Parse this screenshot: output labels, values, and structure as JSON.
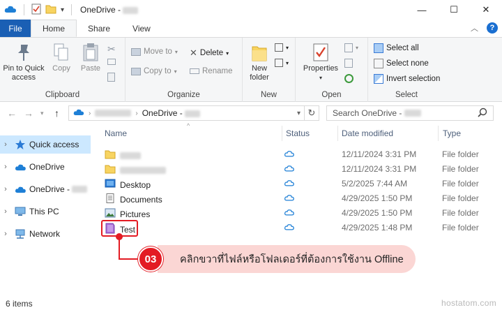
{
  "window": {
    "title": "OneDrive -",
    "buttons": {
      "minimize": "—",
      "maximize": "☐",
      "close": "✕"
    }
  },
  "ribbon_tabs": [
    {
      "label": "File"
    },
    {
      "label": "Home"
    },
    {
      "label": "Share"
    },
    {
      "label": "View"
    }
  ],
  "ribbon": {
    "clipboard": {
      "label": "Clipboard",
      "pin_line1": "Pin to Quick",
      "pin_line2": "access",
      "copy": "Copy",
      "paste": "Paste"
    },
    "organize": {
      "label": "Organize",
      "move_to": "Move to",
      "copy_to": "Copy to",
      "delete": "Delete",
      "rename": "Rename"
    },
    "new": {
      "label": "New",
      "new_folder_line1": "New",
      "new_folder_line2": "folder"
    },
    "open": {
      "label": "Open",
      "properties": "Properties"
    },
    "select": {
      "label": "Select",
      "select_all": "Select all",
      "select_none": "Select none",
      "invert_selection": "Invert selection"
    }
  },
  "address": {
    "path_current": "OneDrive -",
    "search_placeholder": "Search OneDrive -"
  },
  "nav_pane": [
    {
      "label": "Quick access",
      "selected": true
    },
    {
      "label": "OneDrive",
      "selected": false
    },
    {
      "label": "OneDrive -",
      "selected": false
    },
    {
      "label": "This PC",
      "selected": false
    },
    {
      "label": "Network",
      "selected": false
    }
  ],
  "columns": {
    "name": "Name",
    "status": "Status",
    "date": "Date modified",
    "type": "Type"
  },
  "files": [
    {
      "name": "",
      "date": "12/11/2024 3:31 PM",
      "type": "File folder",
      "icon": "folder-icon",
      "blurred": true
    },
    {
      "name": "",
      "date": "12/11/2024 3:31 PM",
      "type": "File folder",
      "icon": "folder-icon",
      "blurred": true
    },
    {
      "name": "Desktop",
      "date": "5/2/2025 7:44 AM",
      "type": "File folder",
      "icon": "desktop-folder-icon"
    },
    {
      "name": "Documents",
      "date": "4/29/2025 1:50 PM",
      "type": "File folder",
      "icon": "documents-folder-icon"
    },
    {
      "name": "Pictures",
      "date": "4/29/2025 1:50 PM",
      "type": "File folder",
      "icon": "pictures-folder-icon"
    },
    {
      "name": "Test",
      "date": "4/29/2025 1:48 PM",
      "type": "File folder",
      "icon": "purple-folder-icon"
    }
  ],
  "status_bar": {
    "item_count": "6 items"
  },
  "callout": {
    "number": "03",
    "text": "คลิกขวาที่ไฟล์หรือโฟลเดอร์ที่ต้องการใช้งาน Offline"
  },
  "watermark": "hostatom.com",
  "colors": {
    "accent": "#1a5fb4",
    "nav_selected": "#cce8ff",
    "callout_red": "#e31b23",
    "callout_bubble": "#fbd6d4",
    "onedrive_blue": "#1e7fd6"
  }
}
